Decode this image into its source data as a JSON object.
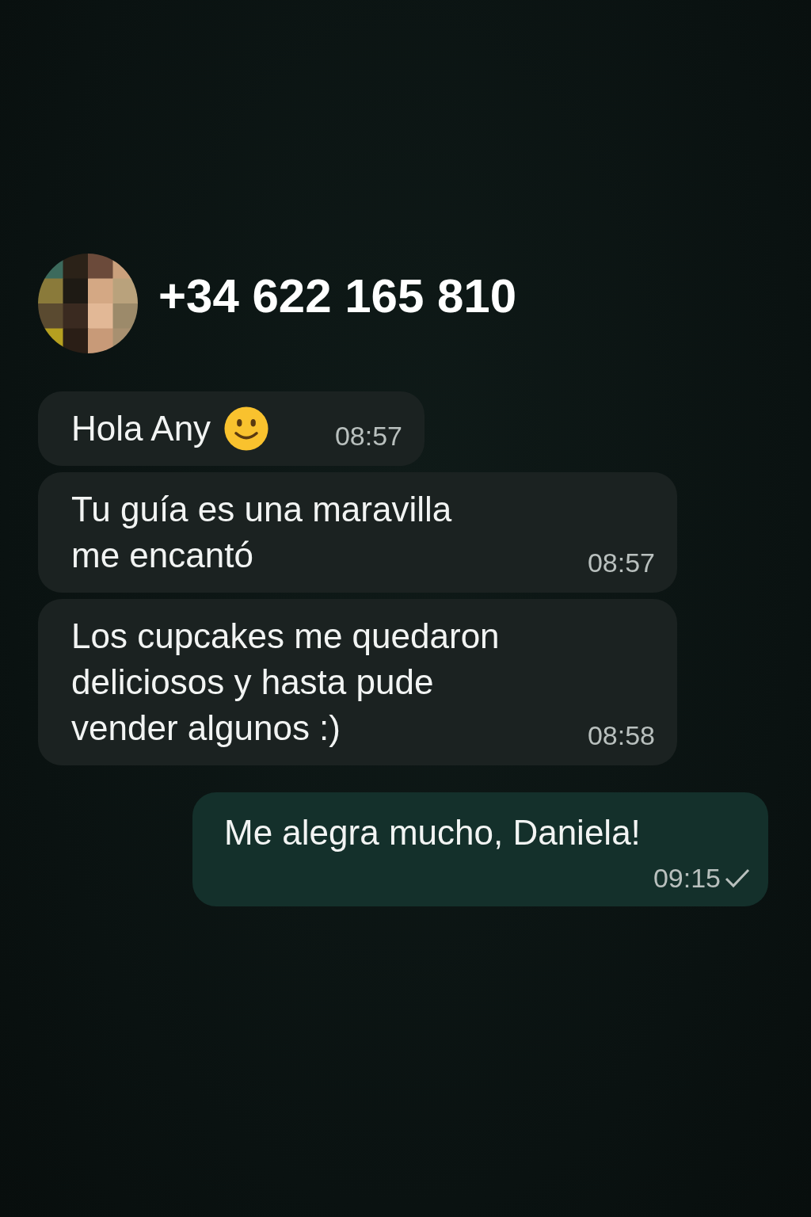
{
  "contact": {
    "phone": "+34 622 165 810"
  },
  "messages": [
    {
      "kind": "incoming",
      "text": "Hola Any",
      "emoji": true,
      "time": "08:57"
    },
    {
      "kind": "incoming",
      "text": "Tu guía es una maravilla\nme encantó",
      "emoji": false,
      "time": "08:57"
    },
    {
      "kind": "incoming",
      "text": "Los cupcakes me quedaron\ndeliciosos y hasta pude\nvender algunos :)",
      "emoji": false,
      "time": "08:58"
    },
    {
      "kind": "outgoing",
      "text": "Me alegra mucho, Daniela!",
      "emoji": false,
      "time": "09:15",
      "sent_tick": true
    }
  ]
}
